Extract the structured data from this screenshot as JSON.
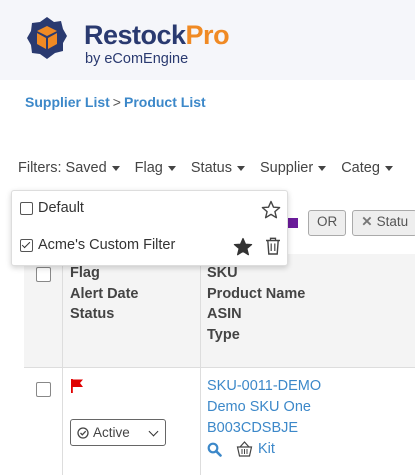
{
  "brand": {
    "name_main": "Restock",
    "name_accent": "Pro",
    "byline": "by eComEngine",
    "colors": {
      "navy": "#2a3a70",
      "orange": "#f08a24"
    }
  },
  "breadcrumb": {
    "items": [
      "Supplier List",
      "Product List"
    ],
    "separator": ">"
  },
  "filters_bar": {
    "items": [
      {
        "label": "Filters: Saved",
        "icon": "caret-down-icon"
      },
      {
        "label": "Flag",
        "icon": "caret-down-icon"
      },
      {
        "label": "Status",
        "icon": "caret-down-icon"
      },
      {
        "label": "Supplier",
        "icon": "caret-down-icon"
      },
      {
        "label": "Categ",
        "icon": "caret-down-icon"
      }
    ]
  },
  "active_filters": {
    "flag_color": "#6a1b9a",
    "operator": "OR",
    "status_chip": "Statu",
    "remove_icon": "x-icon"
  },
  "saved_filters_dropdown": {
    "items": [
      {
        "label": "Default",
        "checked": false,
        "favorite": false,
        "icon": "star-outline-icon"
      },
      {
        "label": "Acme's Custom Filter",
        "checked": true,
        "favorite": true,
        "icon": "star-filled-icon",
        "delete_icon": "trash-icon"
      }
    ]
  },
  "table": {
    "headers": {
      "col1": [
        "Flag",
        "Alert Date",
        "Status"
      ],
      "col2": [
        "SKU",
        "Product Name",
        "ASIN",
        "Type"
      ]
    },
    "rows": [
      {
        "flag_color": "#e00000",
        "status": "Active",
        "sku": "SKU-0011-DEMO",
        "product_name": "Demo SKU One",
        "asin": "B003CDSBJE",
        "type": "Kit",
        "search_icon": "search-icon",
        "type_icon": "basket-icon"
      }
    ]
  }
}
